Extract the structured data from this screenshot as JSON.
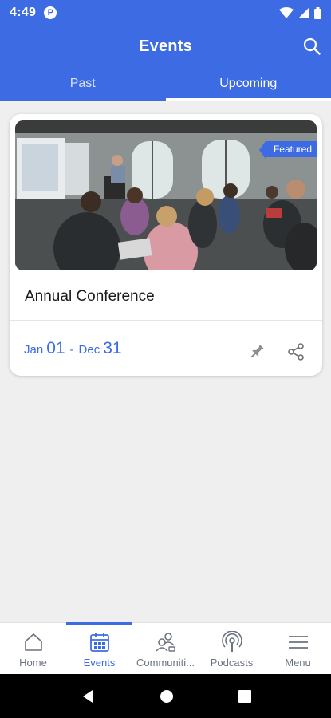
{
  "status_bar": {
    "time": "4:49",
    "app_icon_letter": "P"
  },
  "app_bar": {
    "title": "Events",
    "search_icon": "search-icon"
  },
  "tabs": [
    {
      "label": "Past",
      "active": false
    },
    {
      "label": "Upcoming",
      "active": true
    }
  ],
  "event_card": {
    "badge": "Featured",
    "title": "Annual Conference",
    "start_month": "Jan",
    "start_day": "01",
    "separator": "-",
    "end_month": "Dec",
    "end_day": "31",
    "image_description_icon": "conference-photo"
  },
  "bottom_nav": [
    {
      "label": "Home",
      "icon": "home-icon",
      "active": false
    },
    {
      "label": "Events",
      "icon": "calendar-icon",
      "active": true
    },
    {
      "label": "Communiti...",
      "icon": "community-icon",
      "active": false
    },
    {
      "label": "Podcasts",
      "icon": "podcast-icon",
      "active": false
    },
    {
      "label": "Menu",
      "icon": "menu-icon",
      "active": false
    }
  ],
  "colors": {
    "primary": "#3d6be4",
    "background": "#efefef",
    "inactive": "#6b7380"
  }
}
